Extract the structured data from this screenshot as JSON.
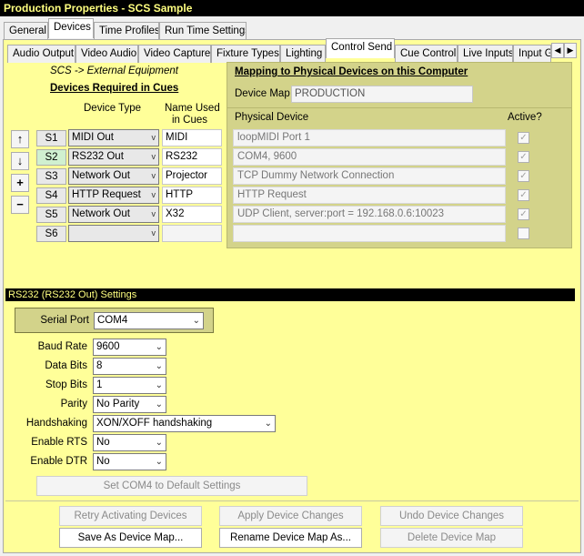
{
  "window": {
    "title": "Production Properties - SCS Sample"
  },
  "main_tabs": [
    "General",
    "Devices",
    "Time Profiles",
    "Run Time Settings"
  ],
  "main_tab_active": "Devices",
  "sub_tabs": [
    "Audio Output",
    "Video Audio",
    "Video Capture",
    "Fixture Types",
    "Lighting",
    "Control Send",
    "Cue Control",
    "Live Inputs",
    "Input Gr"
  ],
  "sub_tab_active": "Control Send",
  "left": {
    "caption": "SCS -> External Equipment",
    "heading": "Devices Required in Cues",
    "col_device_type": "Device Type",
    "col_name_used_1": "Name Used",
    "col_name_used_2": "in Cues",
    "rows": [
      {
        "id": "S1",
        "type": "MIDI Out",
        "name": "MIDI"
      },
      {
        "id": "S2",
        "type": "RS232 Out",
        "name": "RS232"
      },
      {
        "id": "S3",
        "type": "Network Out",
        "name": "Projector"
      },
      {
        "id": "S4",
        "type": "HTTP Request",
        "name": "HTTP"
      },
      {
        "id": "S5",
        "type": "Network Out",
        "name": "X32"
      },
      {
        "id": "S6",
        "type": "",
        "name": ""
      }
    ],
    "side_buttons": [
      "↑",
      "↓",
      "+",
      "−"
    ]
  },
  "mapping": {
    "title": "Mapping to Physical Devices on this Computer",
    "device_map_label": "Device Map",
    "device_map_value": "PRODUCTION",
    "col_physical": "Physical Device",
    "col_active": "Active?",
    "rows": [
      {
        "device": "loopMIDI Port 1",
        "active": true
      },
      {
        "device": "COM4, 9600",
        "active": true
      },
      {
        "device": "TCP Dummy Network Connection",
        "active": true
      },
      {
        "device": "HTTP Request",
        "active": true
      },
      {
        "device": "UDP Client, server:port = 192.168.0.6:10023",
        "active": true
      },
      {
        "device": "",
        "active": false
      }
    ]
  },
  "rs232": {
    "section_title": "RS232 (RS232 Out) Settings",
    "serial_port_label": "Serial Port",
    "serial_port_value": "COM4",
    "fields": [
      {
        "label": "Baud Rate",
        "value": "9600"
      },
      {
        "label": "Data Bits",
        "value": "8"
      },
      {
        "label": "Stop Bits",
        "value": "1"
      },
      {
        "label": "Parity",
        "value": "No Parity"
      },
      {
        "label": "Handshaking",
        "value": "XON/XOFF handshaking"
      },
      {
        "label": "Enable RTS",
        "value": "No"
      },
      {
        "label": "Enable DTR",
        "value": "No"
      }
    ],
    "default_button": "Set COM4 to Default Settings"
  },
  "bottom_buttons": {
    "retry": "Retry Activating Devices",
    "apply": "Apply Device Changes",
    "undo": "Undo Device Changes",
    "save_as": "Save As Device Map...",
    "rename": "Rename Device Map As...",
    "delete": "Delete Device Map"
  },
  "colors": {
    "panel": "#ffff99",
    "title_text": "#ffff80",
    "mapping_bg": "#d3d38a"
  }
}
